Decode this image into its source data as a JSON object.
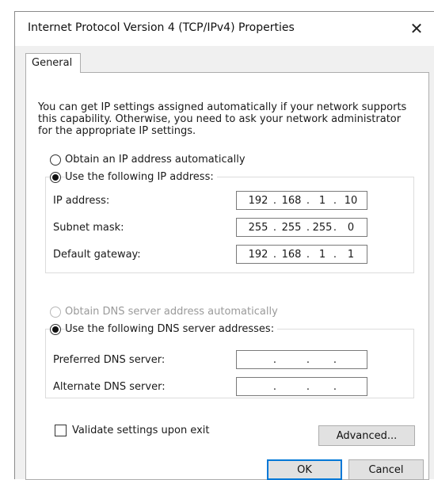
{
  "window": {
    "title": "Internet Protocol Version 4 (TCP/IPv4) Properties",
    "close_glyph": "✕"
  },
  "tabs": [
    {
      "label": "General",
      "selected": true
    }
  ],
  "intro_text": "You can get IP settings assigned automatically if your network supports this capability. Otherwise, you need to ask your network administrator for the appropriate IP settings.",
  "ip_mode": {
    "auto_label": "Obtain an IP address automatically",
    "manual_label": "Use the following IP address:",
    "selected": "manual"
  },
  "ip_fields": [
    {
      "label": "IP address:",
      "octets": [
        "192",
        "168",
        "1",
        "10"
      ]
    },
    {
      "label": "Subnet mask:",
      "octets": [
        "255",
        "255",
        "255",
        "0"
      ]
    },
    {
      "label": "Default gateway:",
      "octets": [
        "192",
        "168",
        "1",
        "1"
      ]
    }
  ],
  "dns_mode": {
    "auto_label": "Obtain DNS server address automatically",
    "manual_label": "Use the following DNS server addresses:",
    "selected": "manual",
    "auto_disabled": true
  },
  "dns_fields": [
    {
      "label": "Preferred DNS server:",
      "octets": [
        "",
        "",
        "",
        ""
      ]
    },
    {
      "label": "Alternate DNS server:",
      "octets": [
        "",
        "",
        "",
        ""
      ]
    }
  ],
  "validate_label": "Validate settings upon exit",
  "validate_checked": false,
  "dot_glyph": ".",
  "buttons": {
    "advanced": "Advanced...",
    "ok": "OK",
    "cancel": "Cancel"
  }
}
